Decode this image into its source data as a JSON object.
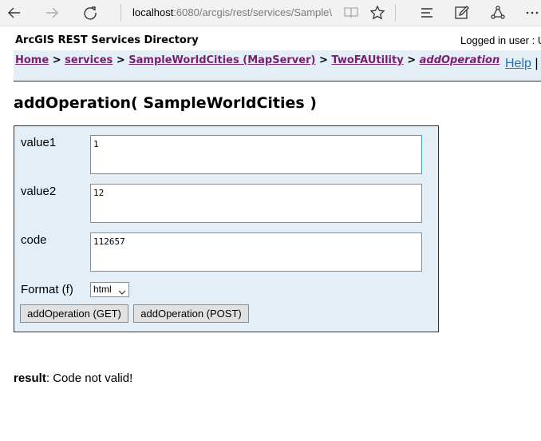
{
  "browser": {
    "url_host": "localhost",
    "url_rest": ":6080/arcgis/rest/services/Sample\\",
    "icons": [
      "back-arrow-icon",
      "forward-arrow-icon",
      "refresh-icon",
      "reading-view-icon",
      "favorite-star-icon",
      "hub-icon",
      "web-note-icon",
      "share-icon",
      "more-icon"
    ]
  },
  "header": {
    "title": "ArcGIS REST Services Directory",
    "logged_in": "Logged in user : U"
  },
  "breadcrumb": {
    "home": "Home",
    "sep1": " > ",
    "services": "services",
    "sep2": " > ",
    "mapserver": "SampleWorldCities (MapServer)",
    "sep3": " > ",
    "utility": "TwoFAUtility",
    "sep4": " > ",
    "operation": "addOperation",
    "help": "Help",
    "pipe": " |"
  },
  "main": {
    "title": "addOperation( SampleWorldCities )",
    "fields": [
      {
        "label": "value1",
        "value": "1"
      },
      {
        "label": "value2",
        "value": "12"
      },
      {
        "label": "code",
        "value": "112657"
      }
    ],
    "format_label": "Format (f)",
    "format_value": "html",
    "get_button": "addOperation (GET)",
    "post_button": "addOperation (POST)"
  },
  "result": {
    "label": "result",
    "text": ": Code not valid!"
  }
}
